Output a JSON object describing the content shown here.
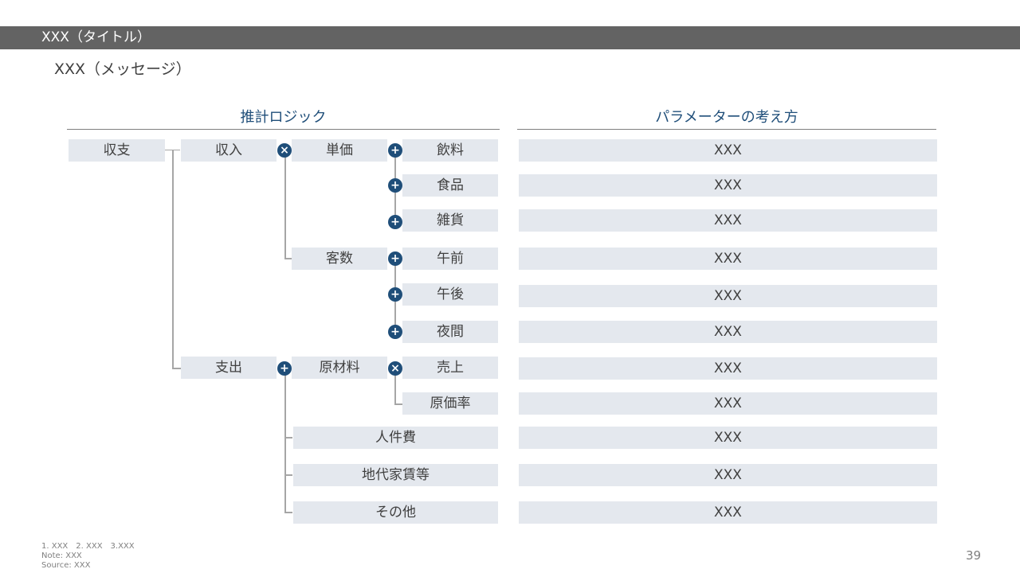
{
  "title": "XXX（タイトル）",
  "message": "XXX（メッセージ）",
  "headers": {
    "logic": "推計ロジック",
    "params": "パラメーターの考え方"
  },
  "tree": {
    "root": "収支",
    "income": "収入",
    "expense": "支出",
    "unit_price": "単価",
    "customers": "客数",
    "raw_materials": "原材料",
    "drinks": "飲料",
    "food": "食品",
    "goods": "雑貨",
    "morning": "午前",
    "afternoon": "午後",
    "night": "夜間",
    "sales": "売上",
    "cost_rate": "原価率",
    "labor": "人件費",
    "rent": "地代家賃等",
    "other": "その他"
  },
  "operators": {
    "plus": "+",
    "times": "×"
  },
  "params": [
    "XXX",
    "XXX",
    "XXX",
    "XXX",
    "XXX",
    "XXX",
    "XXX",
    "XXX",
    "XXX",
    "XXX",
    "XXX"
  ],
  "footnotes": {
    "numbered": "1. XXX　2. XXX　3.XXX",
    "note": "Note: XXX",
    "source": "Source: XXX"
  },
  "page_number": "39"
}
